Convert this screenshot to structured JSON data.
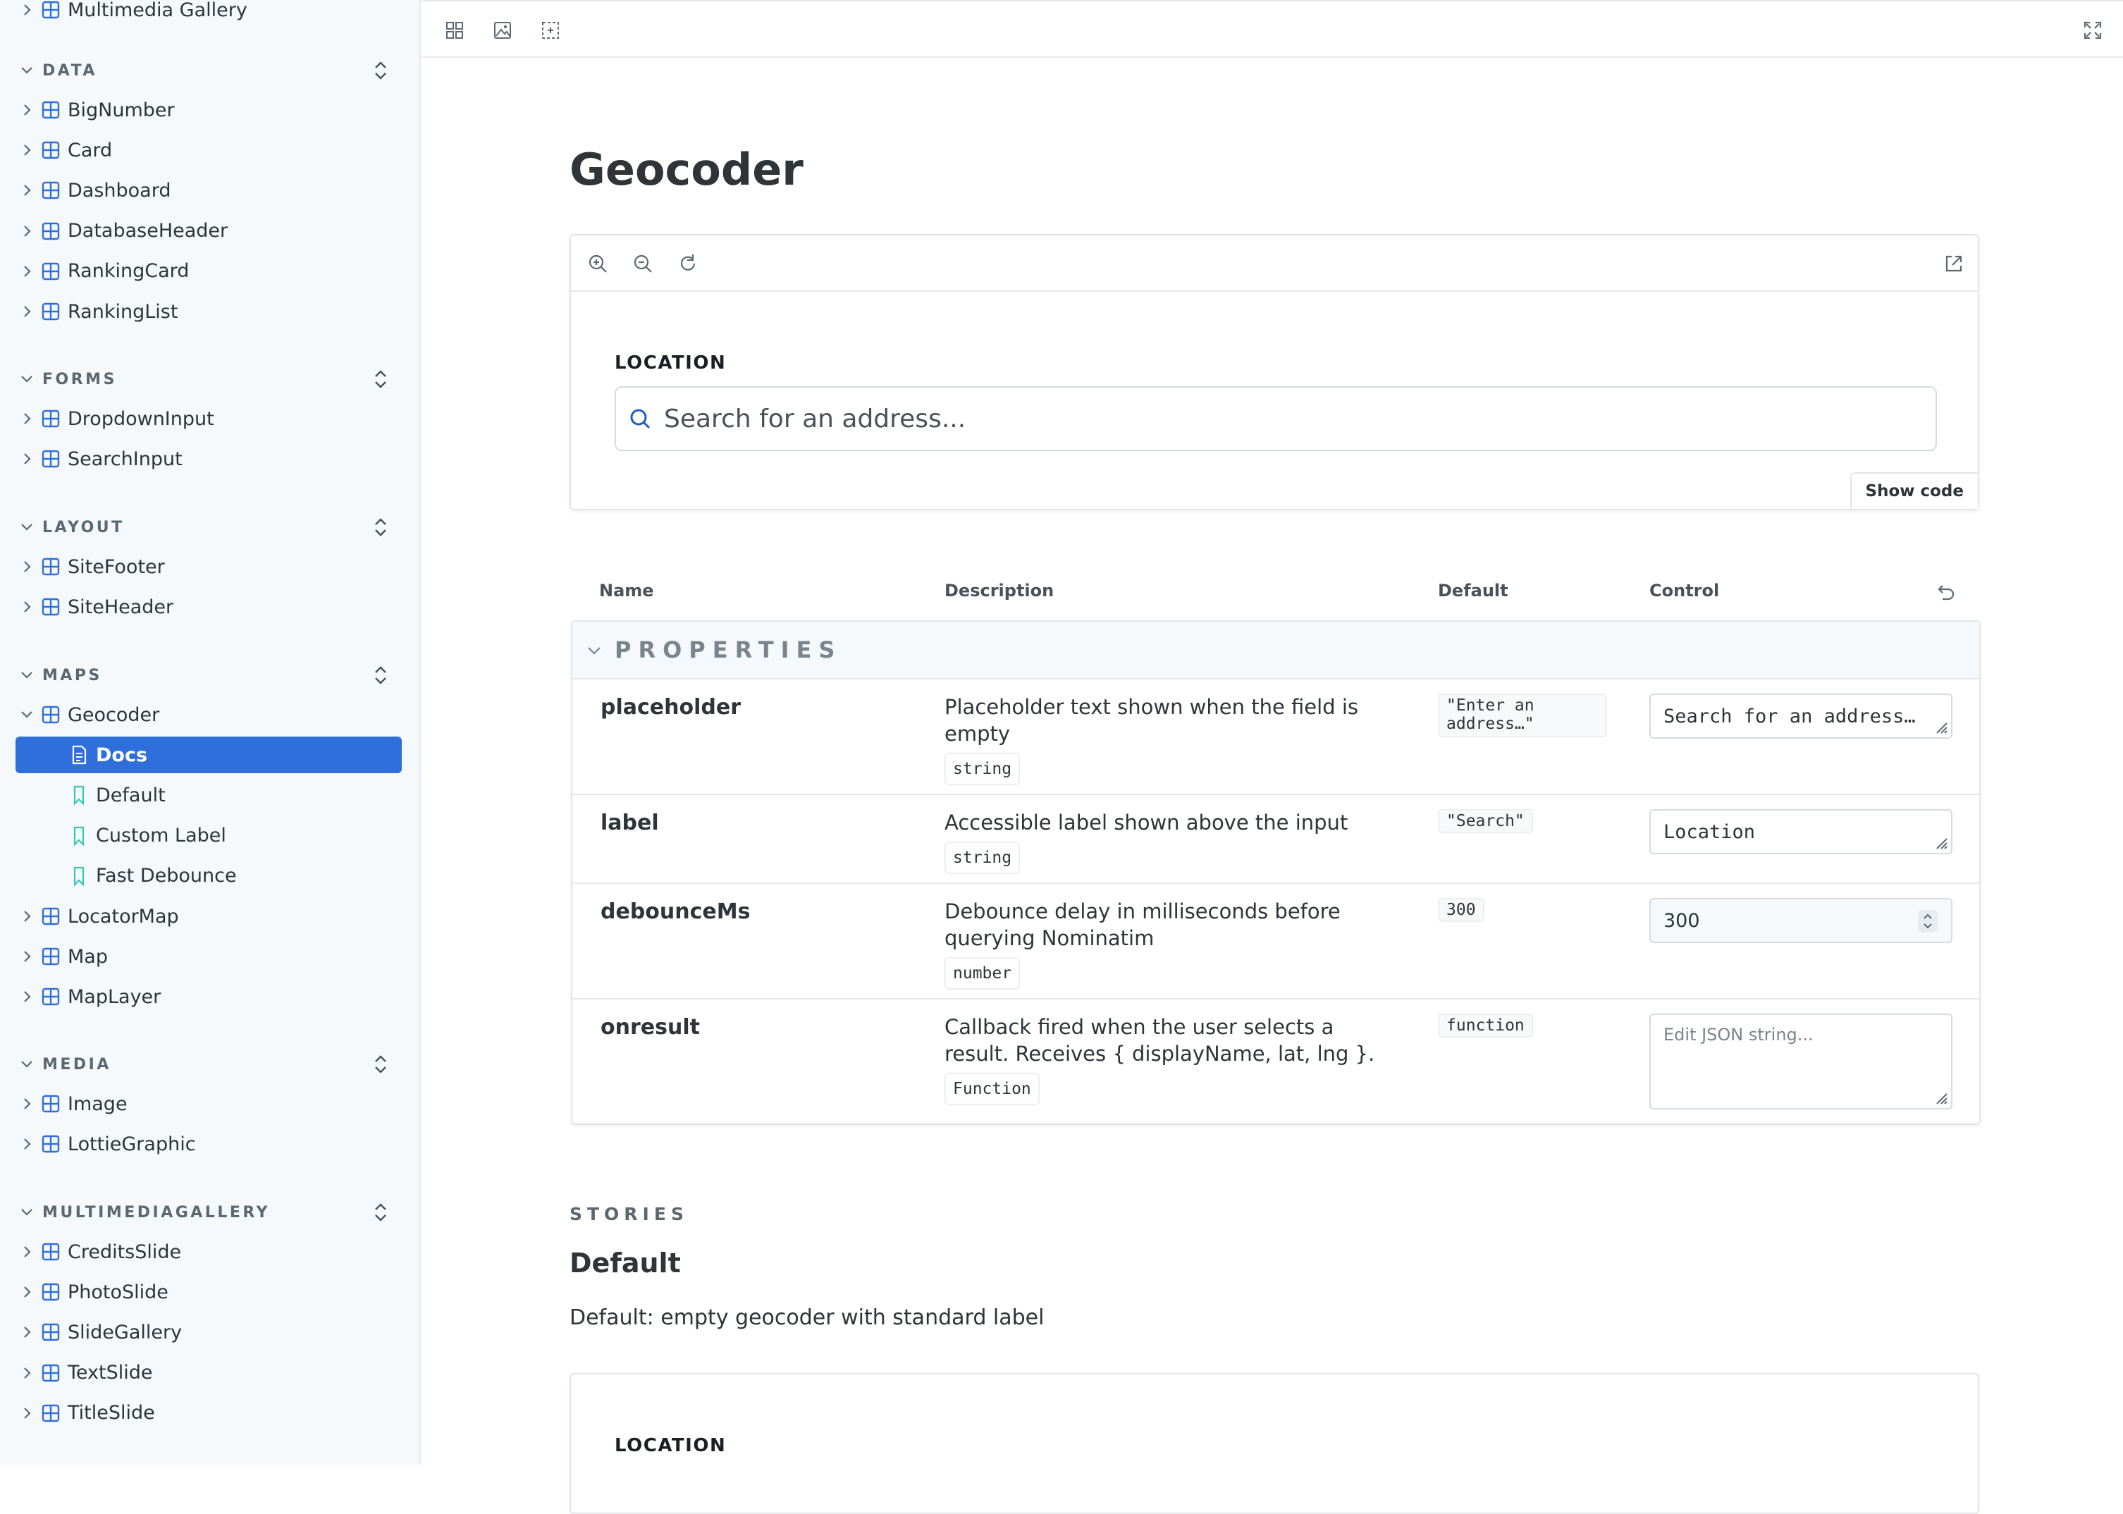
{
  "sidebar": {
    "top_item": "Multimedia Gallery",
    "groups": [
      {
        "title": "DATA",
        "items": [
          "BigNumber",
          "Card",
          "Dashboard",
          "DatabaseHeader",
          "RankingCard",
          "RankingList"
        ]
      },
      {
        "title": "FORMS",
        "items": [
          "DropdownInput",
          "SearchInput"
        ]
      },
      {
        "title": "LAYOUT",
        "items": [
          "SiteFooter",
          "SiteHeader"
        ]
      },
      {
        "title": "MAPS",
        "items": [
          "Geocoder",
          "LocatorMap",
          "Map",
          "MapLayer"
        ]
      },
      {
        "title": "MEDIA",
        "items": [
          "Image",
          "LottieGraphic"
        ]
      },
      {
        "title": "MULTIMEDIAGALLERY",
        "items": [
          "CreditsSlide",
          "PhotoSlide",
          "SlideGallery",
          "TextSlide",
          "TitleSlide"
        ]
      }
    ],
    "geocoder_children": [
      "Docs",
      "Default",
      "Custom Label",
      "Fast Debounce"
    ],
    "selected": "Docs"
  },
  "doc": {
    "title": "Geocoder",
    "preview": {
      "label": "LOCATION",
      "placeholder": "Search for an address...",
      "show_code": "Show code"
    }
  },
  "args_table": {
    "headers": {
      "name": "Name",
      "description": "Description",
      "default": "Default",
      "control": "Control"
    },
    "section": "PROPERTIES",
    "rows": [
      {
        "name": "placeholder",
        "description": "Placeholder text shown when the field is empty",
        "type": "string",
        "default_l1": "\"Enter an",
        "default_l2": "address…\"",
        "control": "Search for an address…"
      },
      {
        "name": "label",
        "description": "Accessible label shown above the input",
        "type": "string",
        "default": "\"Search\"",
        "control": "Location"
      },
      {
        "name": "debounceMs",
        "description": "Debounce delay in milliseconds before querying Nominatim",
        "type": "number",
        "default": "300",
        "control": "300"
      },
      {
        "name": "onresult",
        "description": "Callback fired when the user selects a result. Receives { displayName, lat, lng }.",
        "type": "Function",
        "default": "function",
        "control_placeholder": "Edit JSON string..."
      }
    ]
  },
  "stories": {
    "label": "STORIES",
    "title": "Default",
    "description": "Default: empty geocoder with standard label",
    "preview_label": "LOCATION"
  },
  "colors": {
    "accent": "#2e6fdb",
    "sidebar_bg": "#f6f9fc",
    "component_icon": "#2e6fdb",
    "story_icon": "#37c7b1"
  }
}
